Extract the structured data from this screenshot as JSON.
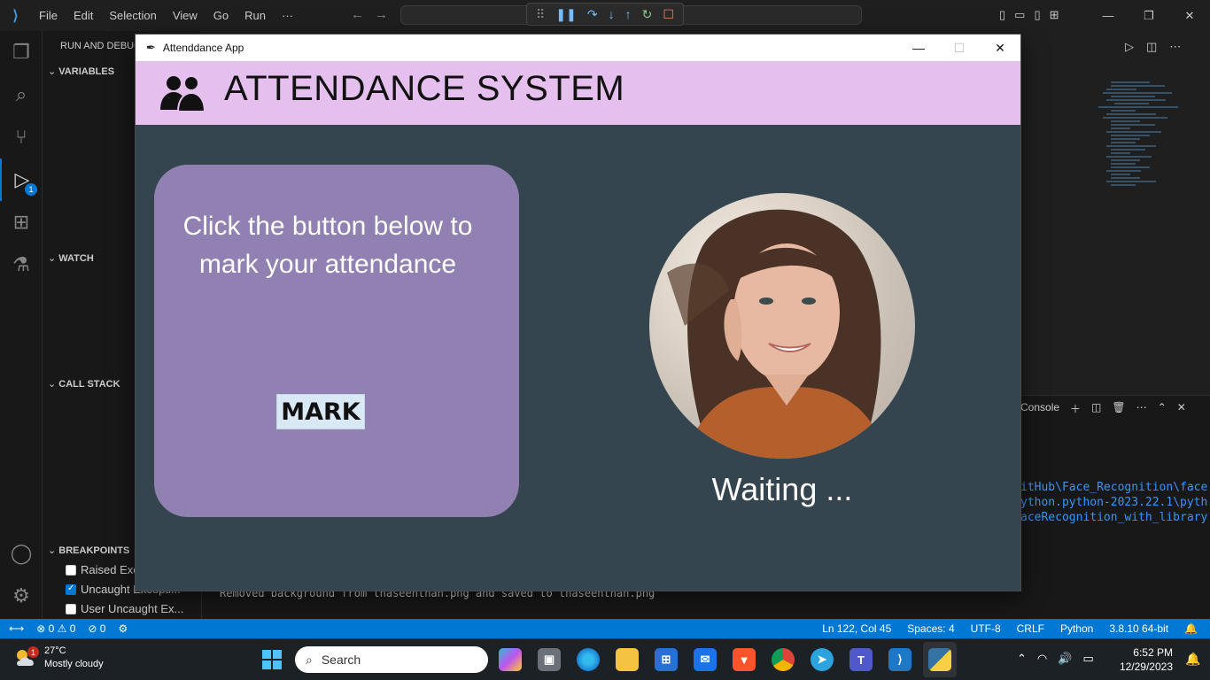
{
  "vscode": {
    "menu": [
      "File",
      "Edit",
      "Selection",
      "View",
      "Go",
      "Run",
      "···"
    ],
    "sidebar_title": "RUN AND DEBUG",
    "sections": {
      "variables": "VARIABLES",
      "watch": "WATCH",
      "call_stack": "CALL STACK",
      "breakpoints": "BREAKPOINTS"
    },
    "breakpoints": [
      {
        "label": "Raised Exce...",
        "checked": false
      },
      {
        "label": "Uncaught Excepti...",
        "checked": true
      },
      {
        "label": "User Uncaught Ex...",
        "checked": false
      }
    ],
    "debug_badge": "1",
    "panel": {
      "header_label": "Console",
      "terminal_lines": [
        "itHub\\Face_Recognition\\face",
        "ython.python-2023.22.1\\pyth",
        "aceRecognition_with_library"
      ],
      "message": "Removed background from thaseenthan.png and saved to thaseenthan.png"
    },
    "statusbar": {
      "errors": "0",
      "warnings": "0",
      "ports": "0",
      "position": "Ln 122, Col 45",
      "spaces": "Spaces: 4",
      "encoding": "UTF-8",
      "eol": "CRLF",
      "language": "Python",
      "interpreter": "3.8.10 64-bit"
    }
  },
  "app": {
    "window_title": "Attenddance App",
    "heading": "ATTENDANCE SYSTEM",
    "instruction": "Click the button below to mark your attendance",
    "mark_button": "MARK",
    "status": "Waiting ..."
  },
  "taskbar": {
    "weather_temp": "27°C",
    "weather_desc": "Mostly cloudy",
    "weather_badge": "1",
    "search_placeholder": "Search",
    "time": "6:52 PM",
    "date": "12/29/2023"
  },
  "colors": {
    "app_header_bg": "#e5bfed",
    "app_body_bg": "#35454f",
    "card_bg": "#9180b2",
    "mark_button_bg": "#d9e8f5",
    "vscode_accent": "#0078d4"
  }
}
